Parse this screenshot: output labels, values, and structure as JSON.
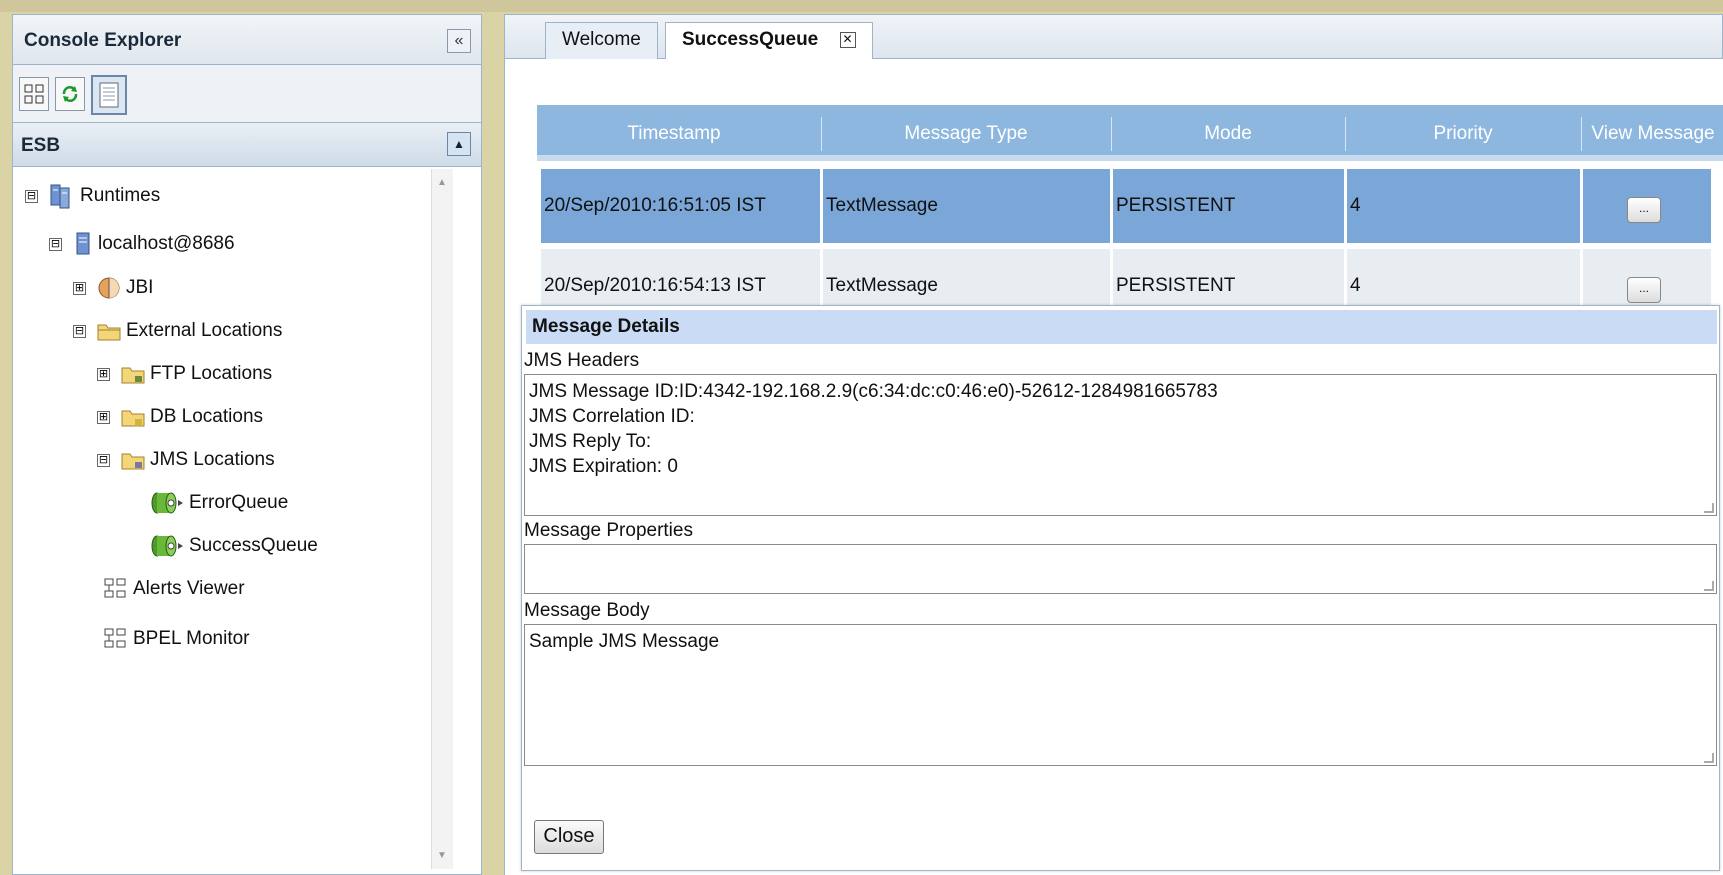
{
  "explorer": {
    "title": "Console Explorer",
    "section": "ESB"
  },
  "tree": [
    {
      "label": "Runtimes",
      "icon": "runtimes-icon",
      "toggle": "⊟",
      "level": 0
    },
    {
      "label": "localhost@8686",
      "icon": "server-icon",
      "toggle": "⊟",
      "level": 1
    },
    {
      "label": "JBI",
      "icon": "jbi-icon",
      "toggle": "⊞",
      "level": 2
    },
    {
      "label": "External Locations",
      "icon": "folder-icon",
      "toggle": "⊟",
      "level": 2
    },
    {
      "label": "FTP Locations",
      "icon": "folder-icon",
      "toggle": "⊞",
      "level": 3
    },
    {
      "label": "DB Locations",
      "icon": "folder-icon",
      "toggle": "⊞",
      "level": 3
    },
    {
      "label": "JMS Locations",
      "icon": "folder-icon",
      "toggle": "⊟",
      "level": 3
    },
    {
      "label": "ErrorQueue",
      "icon": "queue-icon",
      "toggle": "",
      "level": 4
    },
    {
      "label": "SuccessQueue",
      "icon": "queue-icon",
      "toggle": "",
      "level": 4
    },
    {
      "label": "Alerts Viewer",
      "icon": "alerts-icon",
      "toggle": "",
      "level": 3
    },
    {
      "label": "BPEL Monitor",
      "icon": "monitor-icon",
      "toggle": "",
      "level": 3
    }
  ],
  "tabs": [
    {
      "label": "Welcome",
      "active": false
    },
    {
      "label": "SuccessQueue",
      "active": true
    }
  ],
  "grid": {
    "columns": [
      "Timestamp",
      "Message Type",
      "Mode",
      "Priority",
      "View Message"
    ],
    "rows": [
      {
        "timestamp": "20/Sep/2010:16:51:05 IST",
        "type": "TextMessage",
        "mode": "PERSISTENT",
        "priority": "4",
        "view": "...",
        "selected": true
      },
      {
        "timestamp": "20/Sep/2010:16:54:13 IST",
        "type": "TextMessage",
        "mode": "PERSISTENT",
        "priority": "4",
        "view": "...",
        "selected": false
      }
    ]
  },
  "dialog": {
    "title": "Message Details",
    "headers_label": "JMS Headers",
    "headers_lines": [
      "JMS Message ID:ID:4342-192.168.2.9(c6:34:dc:c0:46:e0)-52612-1284981665783",
      "JMS Correlation ID:",
      "JMS Reply To:",
      "JMS Expiration: 0"
    ],
    "properties_label": "Message Properties",
    "properties_value": "",
    "body_label": "Message Body",
    "body_value": "Sample JMS Message",
    "close_label": "Close"
  }
}
